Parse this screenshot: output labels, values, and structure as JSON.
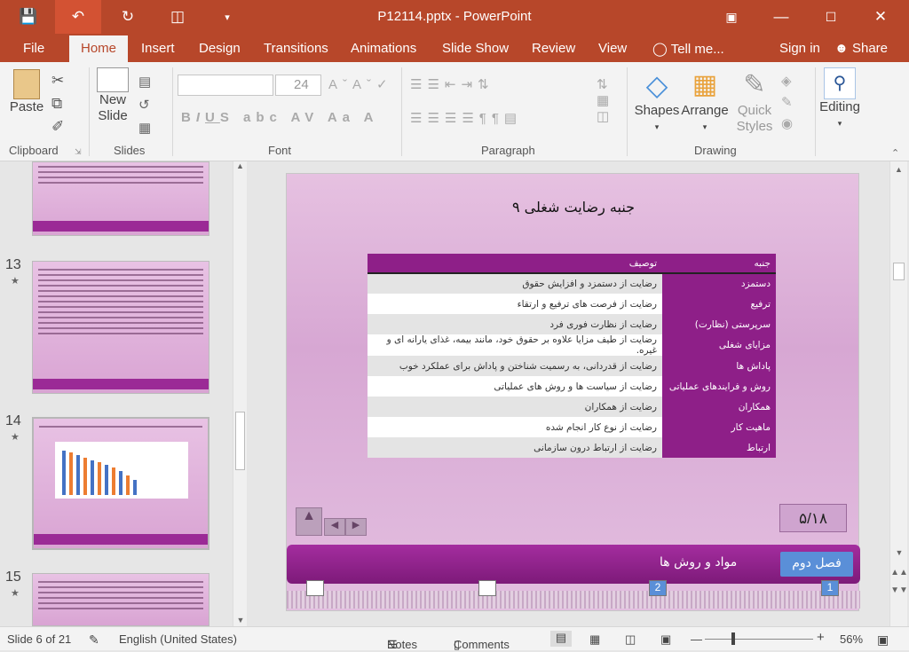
{
  "window": {
    "title": "P12114.pptx - PowerPoint"
  },
  "tabs": [
    "File",
    "Home",
    "Insert",
    "Design",
    "Transitions",
    "Animations",
    "Slide Show",
    "Review",
    "View"
  ],
  "tell_me": "Tell me...",
  "sign_in": "Sign in",
  "share": "Share",
  "ribbon": {
    "paste": "Paste",
    "new_slide_1": "New",
    "new_slide_2": "Slide",
    "font_size": "24",
    "shapes": "Shapes",
    "arrange": "Arrange",
    "quick_styles_1": "Quick",
    "quick_styles_2": "Styles",
    "editing": "Editing",
    "groups": {
      "clipboard": "Clipboard",
      "slides": "Slides",
      "font": "Font",
      "paragraph": "Paragraph",
      "drawing": "Drawing"
    }
  },
  "thumbnails": [
    {
      "num": "13"
    },
    {
      "num": "14"
    },
    {
      "num": "15"
    }
  ],
  "slide": {
    "title": "۹ جنبه رضایت شغلی",
    "table": {
      "headers": [
        "جنبه",
        "توصیف"
      ],
      "rows": [
        [
          "دستمزد",
          "رضایت از دستمزد و افزایش حقوق"
        ],
        [
          "ترفیع",
          "رضایت از فرصت های ترفیع و ارتقاء"
        ],
        [
          "سرپرستی (نظارت)",
          "رضایت از نظارت فوری فرد"
        ],
        [
          "مزایای شغلی",
          "رضایت از طیف مزایا علاوه بر حقوق خود، مانند بیمه، غذای یارانه ای و غیره."
        ],
        [
          "پاداش ها",
          "رضایت از قدردانی، به رسمیت شناختن و پاداش برای عملکرد خوب"
        ],
        [
          "روش و فرایندهای عملیاتی",
          "رضایت از سیاست ها و روش های عملیاتی"
        ],
        [
          "همکاران",
          "رضایت از همکاران"
        ],
        [
          "ماهیت کار",
          "رضایت از نوع کار انجام شده"
        ],
        [
          "ارتباط",
          "رضایت از ارتباط درون سازمانی"
        ]
      ]
    },
    "page_number": "۵/۱۸",
    "section": "فصل دوم",
    "subtitle": "مواد و روش ها",
    "marker1": "1",
    "marker2": "2"
  },
  "status": {
    "slide_of": "Slide 6 of 21",
    "language": "English (United States)",
    "notes": "Notes",
    "comments": "Comments",
    "zoom": "56%"
  }
}
